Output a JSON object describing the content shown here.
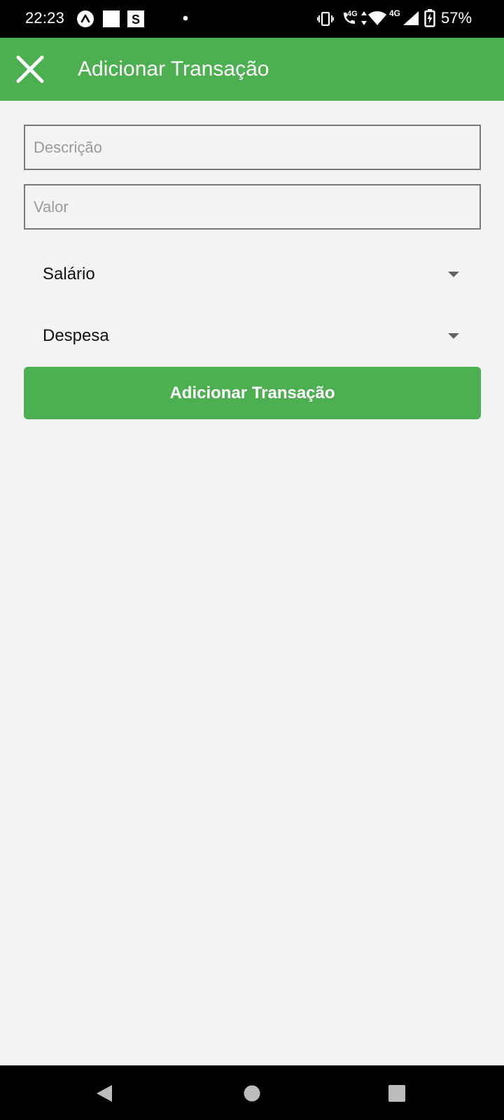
{
  "status_bar": {
    "time": "22:23",
    "battery_percent": "57%",
    "network_label_1": "4G",
    "network_label_2": "4G",
    "notification_icons": [
      "expo-icon",
      "white-square-icon",
      "s-app-icon",
      "dot-icon"
    ],
    "system_icons": [
      "vibrate-icon",
      "volte-call-icon",
      "data-arrows-icon",
      "wifi-icon",
      "cell-signal-icon",
      "battery-charging-icon"
    ]
  },
  "app_bar": {
    "title": "Adicionar Transação",
    "close_icon": "close-icon",
    "color": "#4caf50"
  },
  "form": {
    "description": {
      "placeholder": "Descrição",
      "value": ""
    },
    "amount": {
      "placeholder": "Valor",
      "value": ""
    },
    "category_select": {
      "selected": "Salário"
    },
    "type_select": {
      "selected": "Despesa"
    },
    "submit_label": "Adicionar Transação"
  },
  "nav_bar": {
    "back_icon": "back-triangle-icon",
    "home_icon": "home-circle-icon",
    "recents_icon": "recents-square-icon"
  }
}
